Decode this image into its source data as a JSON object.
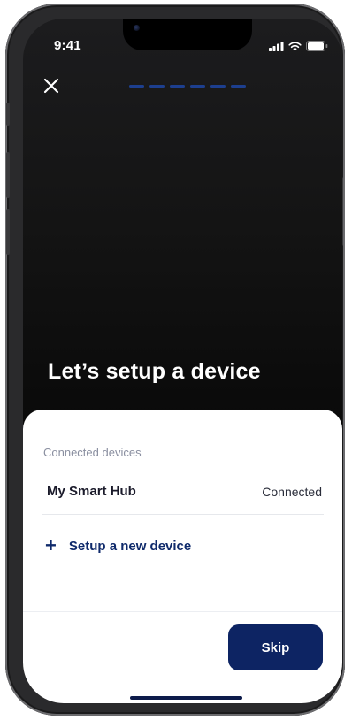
{
  "status_bar": {
    "time": "9:41",
    "icons": [
      "cellular-signal-icon",
      "wifi-icon",
      "battery-icon"
    ]
  },
  "header": {
    "close_icon": "close-icon",
    "progress_segments": 6,
    "progress_color": "#1d3f8f"
  },
  "headline": "Let’s setup a device",
  "sheet": {
    "section_label": "Connected devices",
    "devices": [
      {
        "name": "My Smart Hub",
        "status": "Connected"
      }
    ],
    "setup_action": {
      "icon": "plus-icon",
      "symbol": "+",
      "label": "Setup a new device"
    },
    "skip_label": "Skip"
  },
  "colors": {
    "brand_navy": "#0d2463",
    "link_navy": "#0f2a6b",
    "muted_label": "#8a8fa0"
  }
}
